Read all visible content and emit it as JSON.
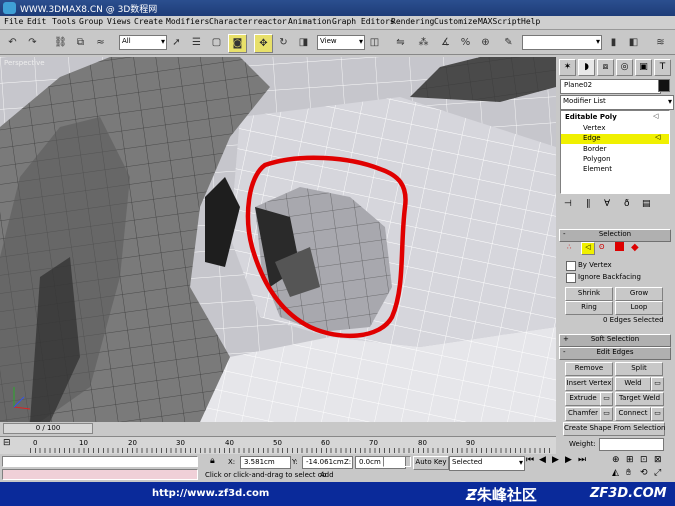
{
  "title": {
    "site": "WWW.3DMAX8.CN",
    "separator": "@",
    "name": "3D数程网"
  },
  "menu": [
    "File",
    "Edit",
    "Tools",
    "Group",
    "Views",
    "Create",
    "Modifiers",
    "Character",
    "reactor",
    "Animation",
    "Graph Editors",
    "Rendering",
    "Customize",
    "MAXScript",
    "Help"
  ],
  "toolbar": {
    "selection_filter": "All",
    "reference_coord": "View"
  },
  "viewport": {
    "label": "Perspective"
  },
  "command_panel": {
    "object_name": "Plane02",
    "modifier_list": "Modifier List",
    "stack": {
      "title": "Editable Poly",
      "items": [
        "Vertex",
        "Edge",
        "Border",
        "Polygon",
        "Element"
      ],
      "selected": "Edge"
    },
    "selection": {
      "header": "Selection",
      "by_vertex": "By Vertex",
      "ignore_backfacing": "Ignore Backfacing",
      "shrink": "Shrink",
      "grow": "Grow",
      "ring": "Ring",
      "loop": "Loop",
      "status": "0 Edges Selected"
    },
    "soft_selection": "Soft Selection",
    "edit_edges": {
      "header": "Edit Edges",
      "remove": "Remove",
      "split": "Split",
      "insert_vertex": "Insert Vertex",
      "weld": "Weld",
      "extrude": "Extrude",
      "target_weld": "Target Weld",
      "chamfer": "Chamfer",
      "connect": "Connect",
      "create_shape": "Create Shape From Selection",
      "weight": "Weight:"
    }
  },
  "timeline": {
    "slider": "0 / 100",
    "ticks": [
      "0",
      "10",
      "20",
      "30",
      "40",
      "50",
      "60",
      "70",
      "80",
      "90"
    ]
  },
  "status": {
    "prompt": "Click or click-and-drag to select ob",
    "add": "Add",
    "x_label": "X:",
    "x_value": "3.581cm",
    "y_label": "Y:",
    "y_value": "-14.061cm",
    "z_label": "Z:",
    "z_value": "0.0cm",
    "auto_key": "Auto Key",
    "key_mode": "Selected"
  },
  "watermark": {
    "url": "http://www.zf3d.com",
    "brand": "朱峰社区",
    "brand_url": "ZF3D.COM"
  },
  "colors": {
    "title_bar": "#1e3c78",
    "selection_highlight": "#f0f000",
    "annotation": "#e00000",
    "watermark_bg": "#0a2a9a"
  }
}
